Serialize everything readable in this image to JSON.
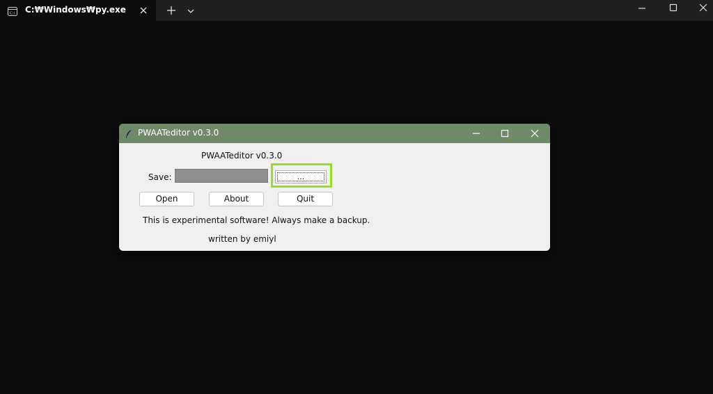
{
  "terminal": {
    "tab_title": "C:₩Windows₩py.exe",
    "icons": {
      "tab": "terminal-icon",
      "close": "close-icon",
      "new_tab": "plus-icon",
      "dropdown": "chevron-down-icon",
      "minimize": "minimize-icon",
      "maximize": "maximize-icon",
      "window_close": "close-icon"
    },
    "colors": {
      "background": "#0c0c0c",
      "titlebar": "#1f1f1f"
    }
  },
  "dialog": {
    "window_title": "PWAATeditor v0.3.0",
    "heading": "PWAATeditor v0.3.0",
    "save_label": "Save:",
    "save_value": "",
    "browse_label": "...",
    "buttons": {
      "open": "Open",
      "about": "About",
      "quit": "Quit"
    },
    "warning": "This is experimental software! Always make a backup.",
    "author": "written by emiyl",
    "colors": {
      "titlebar": "#6e8a67",
      "body": "#f0f0f0",
      "highlight": "#93e21a"
    }
  }
}
